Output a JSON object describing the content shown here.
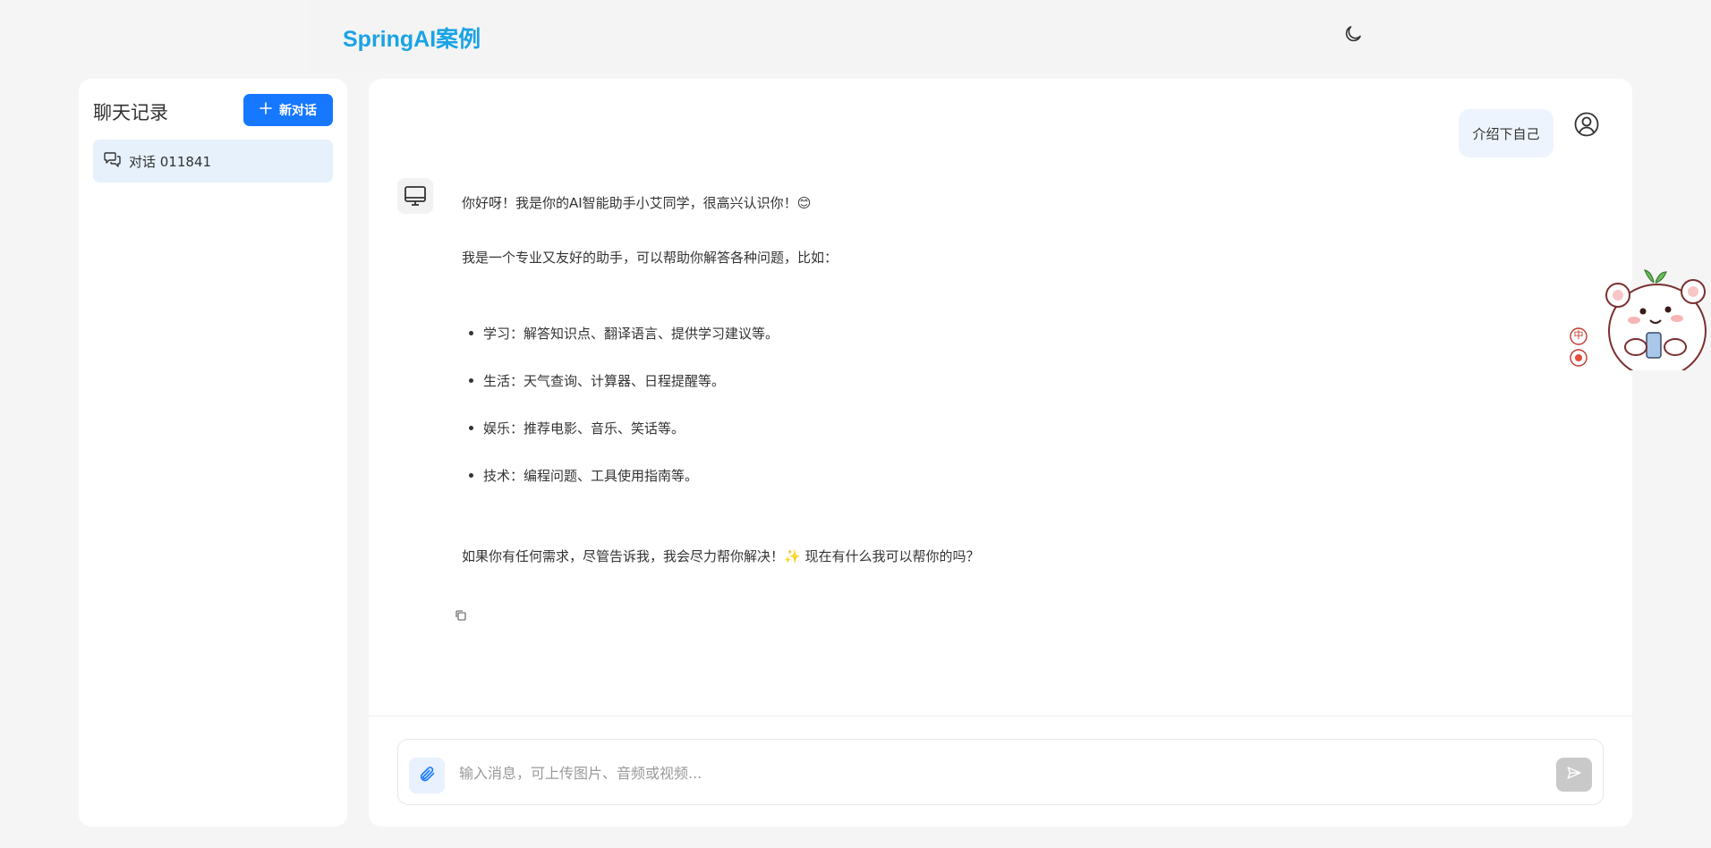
{
  "header": {
    "brand": "SpringAI案例",
    "theme_icon": "moon-icon"
  },
  "sidebar": {
    "title": "聊天记录",
    "new_chat_label": "新对话",
    "conversations": [
      {
        "label": "对话 011841",
        "icon": "chat-bubbles-icon"
      }
    ]
  },
  "chat": {
    "user_message": "介绍下自己",
    "ai_lines": {
      "greeting": "你好呀！我是你的AI智能助手小艾同学，很高兴认识你！😊",
      "intro": "我是一个专业又友好的助手，可以帮助你解答各种问题，比如：",
      "items": [
        "学习：解答知识点、翻译语言、提供学习建议等。",
        "生活：天气查询、计算器、日程提醒等。",
        "娱乐：推荐电影、音乐、笑话等。",
        "技术：编程问题、工具使用指南等。"
      ],
      "closing": "如果你有任何需求，尽管告诉我，我会尽力帮你解决！✨ 现在有什么我可以帮你的吗？"
    }
  },
  "composer": {
    "placeholder": "输入消息，可上传图片、音频或视频...",
    "value": ""
  },
  "widget": {
    "lang_badge": "中"
  },
  "colors": {
    "brand": "#1aa3e6",
    "primary": "#1677ff",
    "active_conversation": "#e6f1fc",
    "send_disabled": "#c9c9c9"
  }
}
